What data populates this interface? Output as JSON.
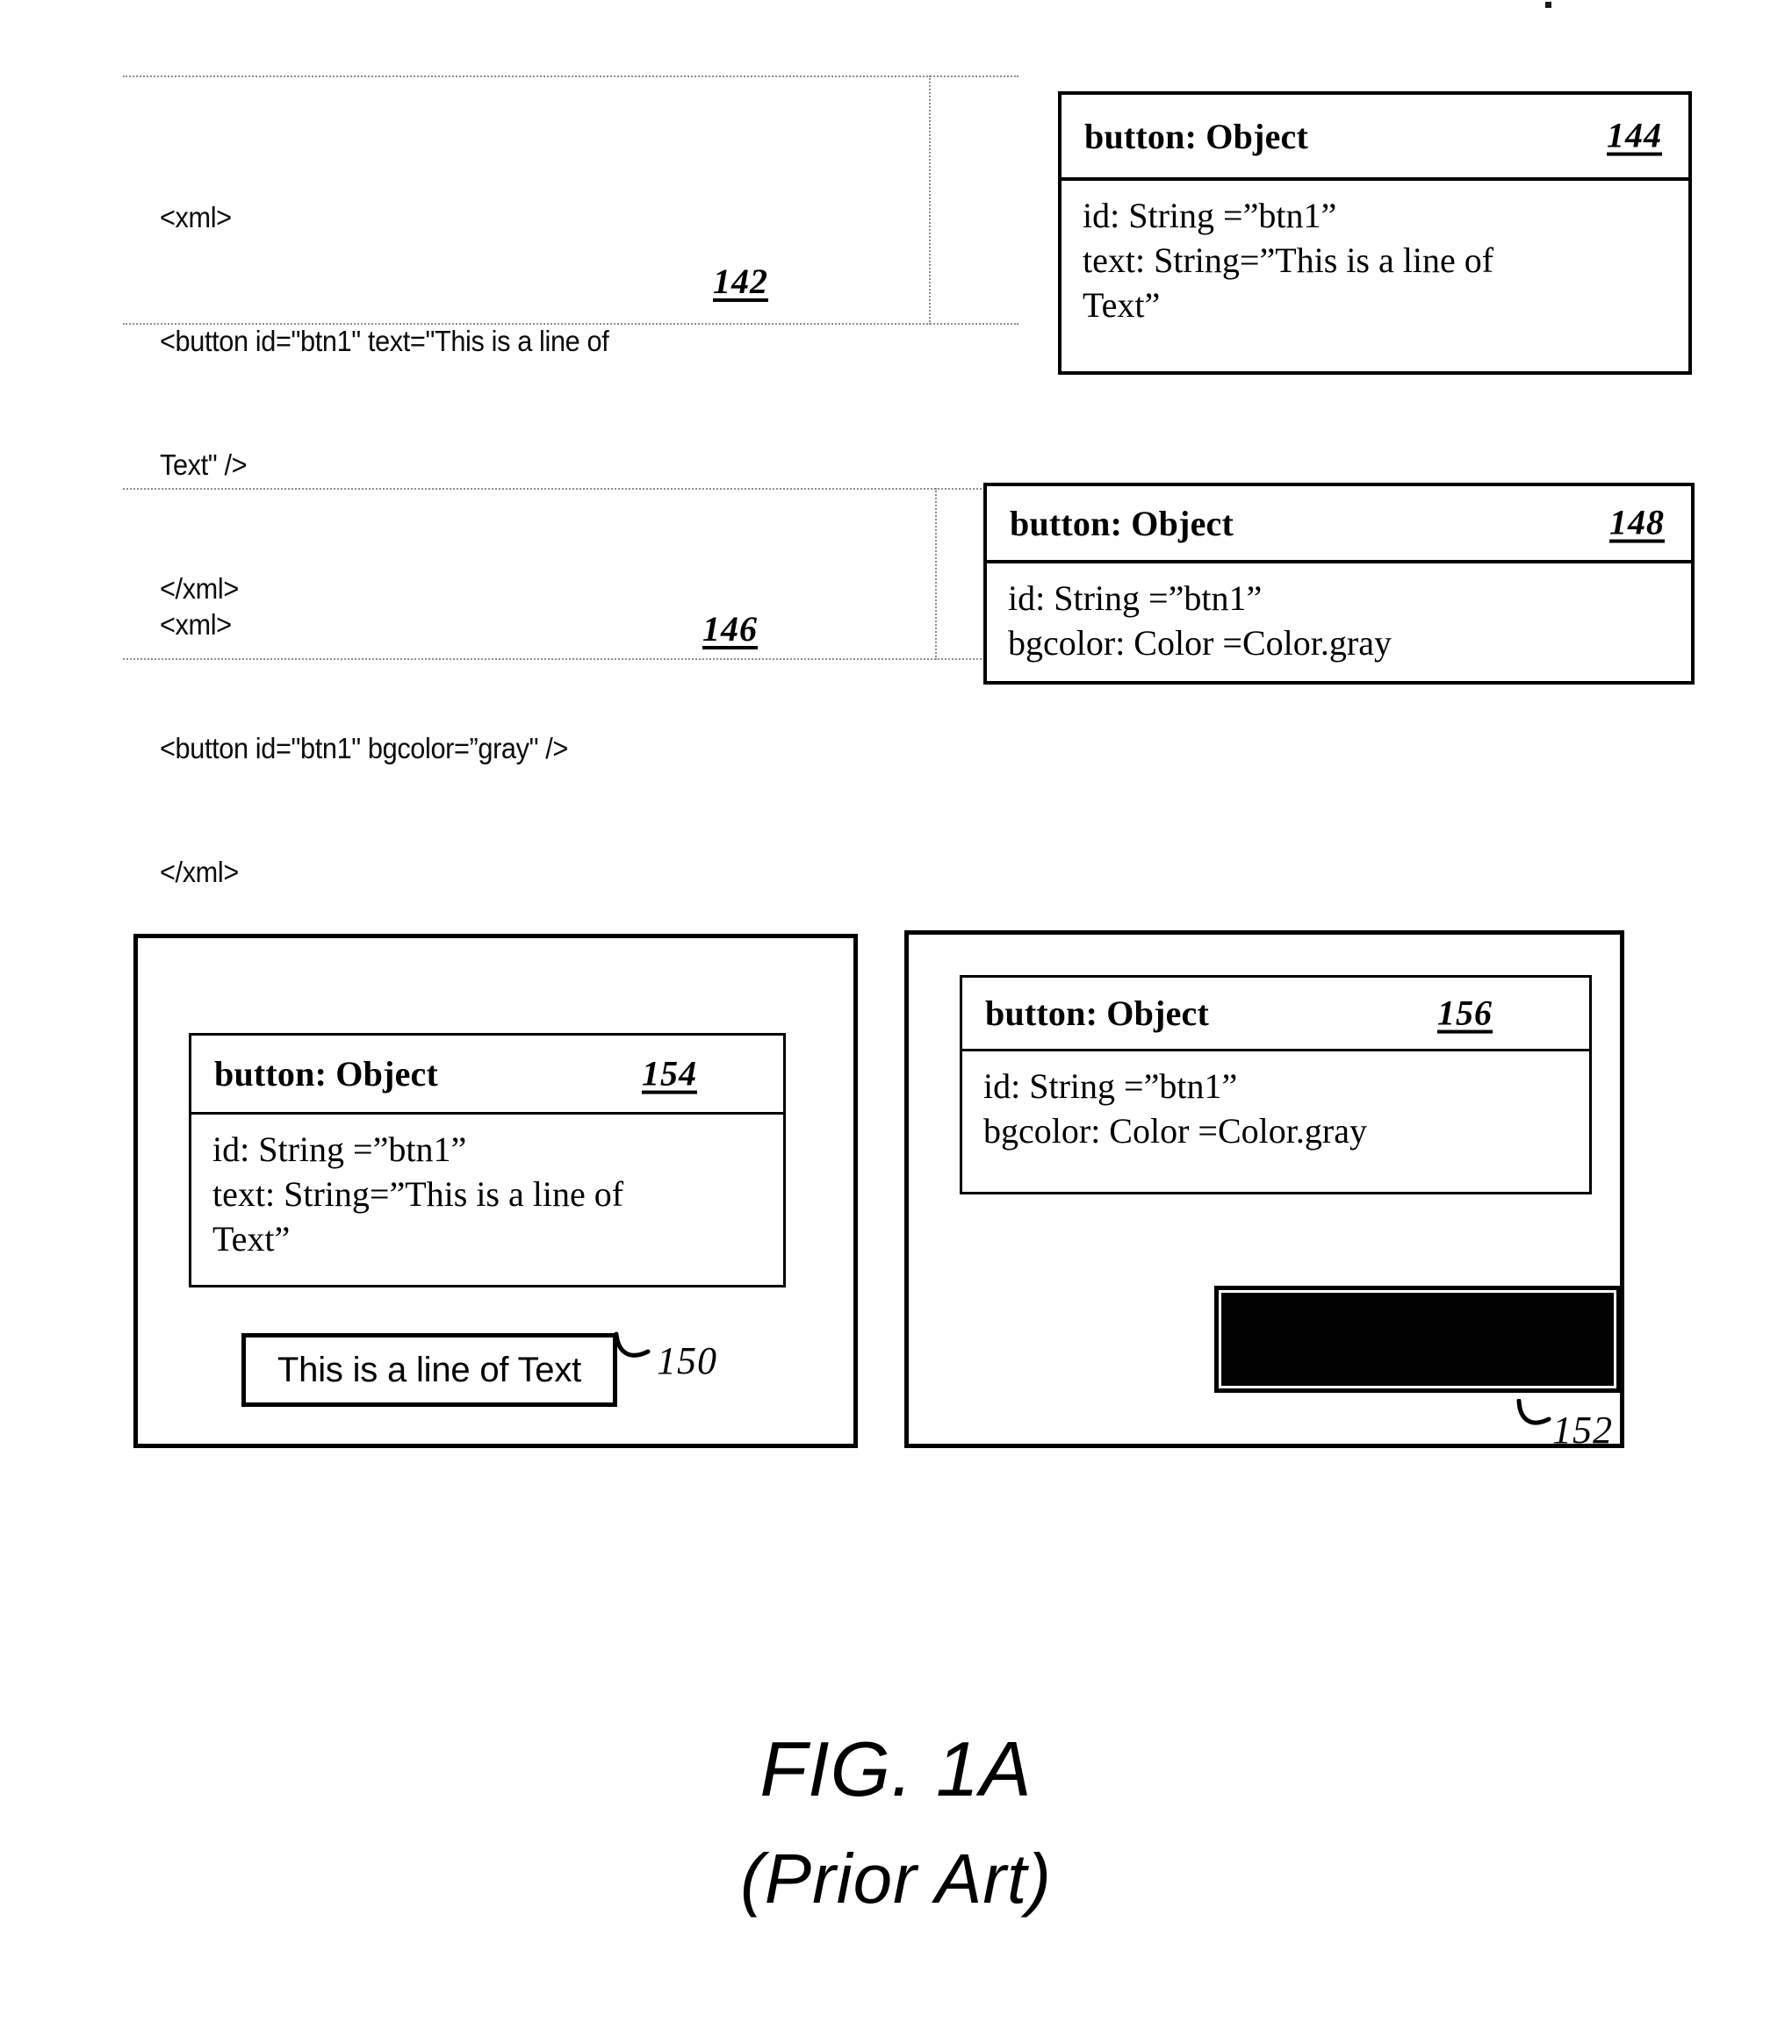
{
  "figure": {
    "caption": "FIG. 1A",
    "subcaption": "(Prior Art)"
  },
  "xml_snippets": [
    {
      "ref": "142",
      "lines": [
        "<xml>",
        "<button id=\"btn1\" text=\"This is a line of",
        "Text\" />",
        "</xml>"
      ]
    },
    {
      "ref": "146",
      "lines": [
        "<xml>",
        "<button id=\"btn1\" bgcolor=”gray\" />",
        "</xml>"
      ]
    }
  ],
  "object_boxes": [
    {
      "ref": "144",
      "title": "button: Object",
      "attributes": [
        "id: String =”btn1”",
        "text: String=”This is a line of",
        "Text”"
      ]
    },
    {
      "ref": "148",
      "title": "button: Object",
      "attributes": [
        "id: String =”btn1”",
        "bgcolor: Color =Color.gray"
      ]
    },
    {
      "ref": "154",
      "title": "button: Object",
      "attributes": [
        "id: String =”btn1”",
        "text: String=”This is a line of",
        "Text”"
      ]
    },
    {
      "ref": "156",
      "title": "button: Object",
      "attributes": [
        "id: String =”btn1”",
        "bgcolor: Color =Color.gray"
      ]
    }
  ],
  "widgets": [
    {
      "ref": "150",
      "kind": "text-button",
      "label": "This is a line of Text"
    },
    {
      "ref": "152",
      "kind": "gray-filled-button",
      "label": "",
      "fill": "#000000"
    }
  ]
}
